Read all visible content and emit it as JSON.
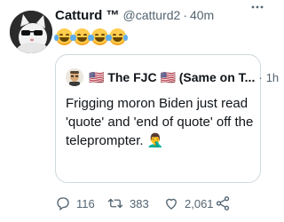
{
  "tweet": {
    "author_name": "Catturd ™",
    "handle": "@catturd2",
    "separator": "·",
    "time": "40m",
    "text_emojis": "😂😂😂😂"
  },
  "quoted_tweet": {
    "author_name": "🇺🇸 The FJC 🇺🇸 (Same on T...",
    "separator": "·",
    "time": "1h",
    "text": "Frigging moron Biden just read 'quote' and 'end of quote' off the teleprompter. 🤦‍♂️"
  },
  "actions": {
    "replies": "116",
    "retweets": "383",
    "likes": "2,061"
  },
  "colors": {
    "secondary_text": "#536471",
    "primary_text": "#0f1419",
    "border": "#cfd9de",
    "background": "#ffffff"
  },
  "icons": [
    "more-icon",
    "reply-icon",
    "retweet-icon",
    "like-icon",
    "share-icon"
  ]
}
